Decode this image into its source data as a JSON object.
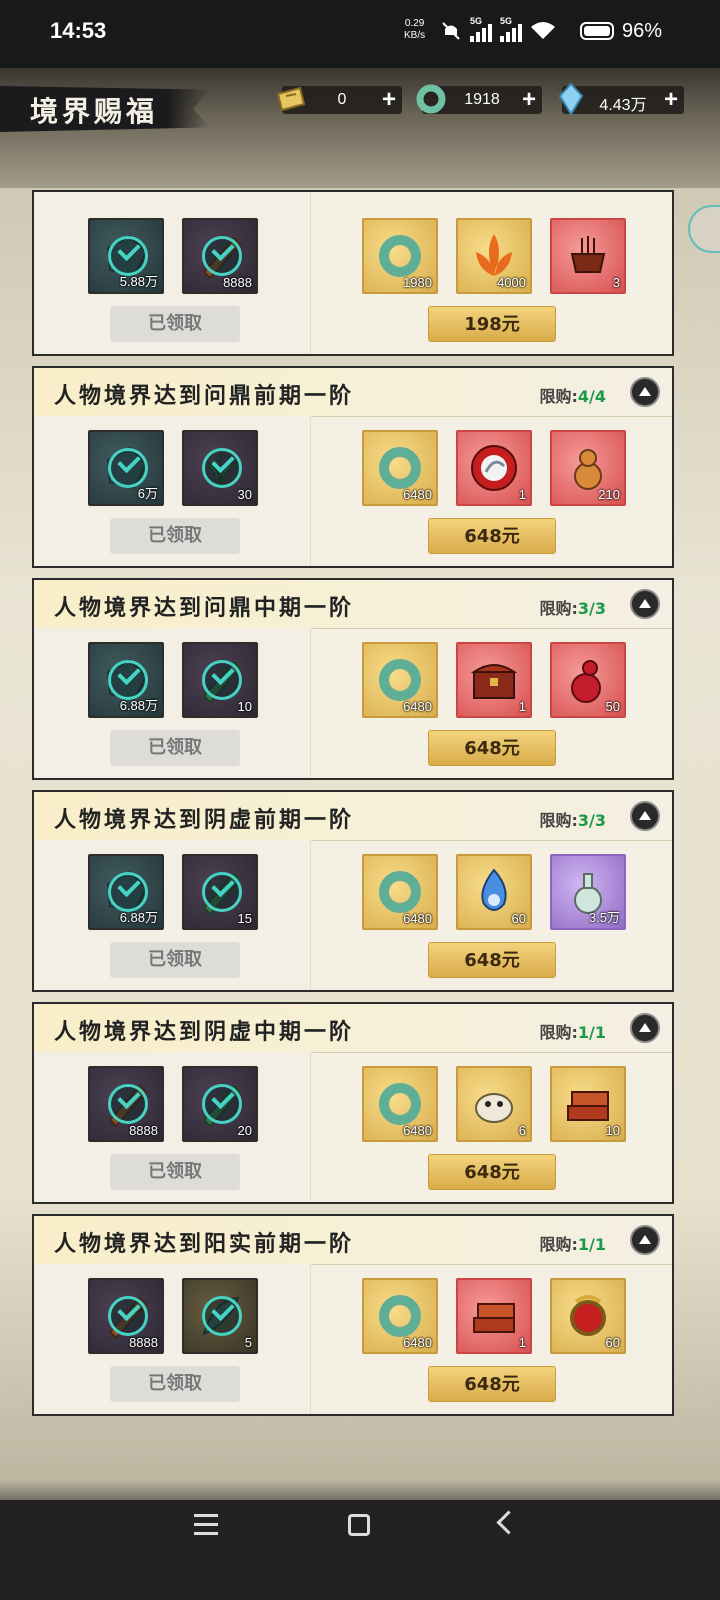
{
  "status_bar": {
    "time": "14:53",
    "speed_value": "0.29",
    "speed_unit": "KB/s",
    "net1": "5G",
    "net2": "5G",
    "battery": "96%"
  },
  "header": {
    "title": "境界赐福",
    "resources": [
      {
        "icon": "ticket-icon",
        "value": "0"
      },
      {
        "icon": "jade-ring-icon",
        "value": "1918"
      },
      {
        "icon": "spirit-crystal-icon",
        "value": "4.43万"
      }
    ],
    "plus": "+"
  },
  "cards": [
    {
      "title": "",
      "limit_label": "",
      "limit_value": "",
      "free_items": [
        {
          "icon": "spirit-stone-icon",
          "qty": "5.88万",
          "style": "teal"
        },
        {
          "icon": "talisman-icon",
          "qty": "8888",
          "style": "purple"
        }
      ],
      "claimed_label": "已领取",
      "paid_items": [
        {
          "icon": "jade-ring-icon",
          "qty": "1980",
          "style": "gold"
        },
        {
          "icon": "flame-lotus-icon",
          "qty": "4000",
          "style": "gold"
        },
        {
          "icon": "incense-burner-icon",
          "qty": "3",
          "style": "red"
        }
      ],
      "price": "198元"
    },
    {
      "title": "人物境界达到问鼎前期一阶",
      "limit_label": "限购:",
      "limit_value": "4/4",
      "free_items": [
        {
          "icon": "spirit-stone-icon",
          "qty": "6万",
          "style": "teal"
        },
        {
          "icon": "herb-icon",
          "qty": "30",
          "style": "purple"
        }
      ],
      "claimed_label": "已领取",
      "paid_items": [
        {
          "icon": "jade-ring-icon",
          "qty": "6480",
          "style": "gold"
        },
        {
          "icon": "dragon-orb-icon",
          "qty": "1",
          "style": "red"
        },
        {
          "icon": "gourd-icon",
          "qty": "210",
          "style": "red"
        }
      ],
      "price": "648元"
    },
    {
      "title": "人物境界达到问鼎中期一阶",
      "limit_label": "限购:",
      "limit_value": "3/3",
      "free_items": [
        {
          "icon": "spirit-stone-icon",
          "qty": "6.88万",
          "style": "teal"
        },
        {
          "icon": "talisman-icon",
          "qty": "10",
          "style": "purple"
        }
      ],
      "claimed_label": "已领取",
      "paid_items": [
        {
          "icon": "jade-ring-icon",
          "qty": "6480",
          "style": "gold"
        },
        {
          "icon": "treasure-chest-icon",
          "qty": "1",
          "style": "red"
        },
        {
          "icon": "red-gourd-icon",
          "qty": "50",
          "style": "red"
        }
      ],
      "price": "648元"
    },
    {
      "title": "人物境界达到阴虚前期一阶",
      "limit_label": "限购:",
      "limit_value": "3/3",
      "free_items": [
        {
          "icon": "spirit-stone-icon",
          "qty": "6.88万",
          "style": "teal"
        },
        {
          "icon": "talisman-icon",
          "qty": "15",
          "style": "purple"
        }
      ],
      "claimed_label": "已领取",
      "paid_items": [
        {
          "icon": "jade-ring-icon",
          "qty": "6480",
          "style": "gold"
        },
        {
          "icon": "blue-flame-icon",
          "qty": "60",
          "style": "gold"
        },
        {
          "icon": "elixir-flask-icon",
          "qty": "3.5万",
          "style": "violet"
        }
      ],
      "price": "648元"
    },
    {
      "title": "人物境界达到阴虚中期一阶",
      "limit_label": "限购:",
      "limit_value": "1/1",
      "free_items": [
        {
          "icon": "talisman-icon",
          "qty": "8888",
          "style": "purple"
        },
        {
          "icon": "talisman-icon",
          "qty": "20",
          "style": "purple"
        }
      ],
      "claimed_label": "已领取",
      "paid_items": [
        {
          "icon": "jade-ring-icon",
          "qty": "6480",
          "style": "gold"
        },
        {
          "icon": "spirit-pet-icon",
          "qty": "6",
          "style": "gold"
        },
        {
          "icon": "manual-stack-icon",
          "qty": "10",
          "style": "gold"
        }
      ],
      "price": "648元"
    },
    {
      "title": "人物境界达到阳实前期一阶",
      "limit_label": "限购:",
      "limit_value": "1/1",
      "free_items": [
        {
          "icon": "talisman-icon",
          "qty": "8888",
          "style": "purple"
        },
        {
          "icon": "feather-icon",
          "qty": "5",
          "style": "olive"
        }
      ],
      "claimed_label": "已领取",
      "paid_items": [
        {
          "icon": "jade-ring-icon",
          "qty": "6480",
          "style": "gold"
        },
        {
          "icon": "manual-stack-icon",
          "qty": "1",
          "style": "red"
        },
        {
          "icon": "phoenix-emblem-icon",
          "qty": "60",
          "style": "gold"
        }
      ],
      "price": "648元"
    }
  ]
}
